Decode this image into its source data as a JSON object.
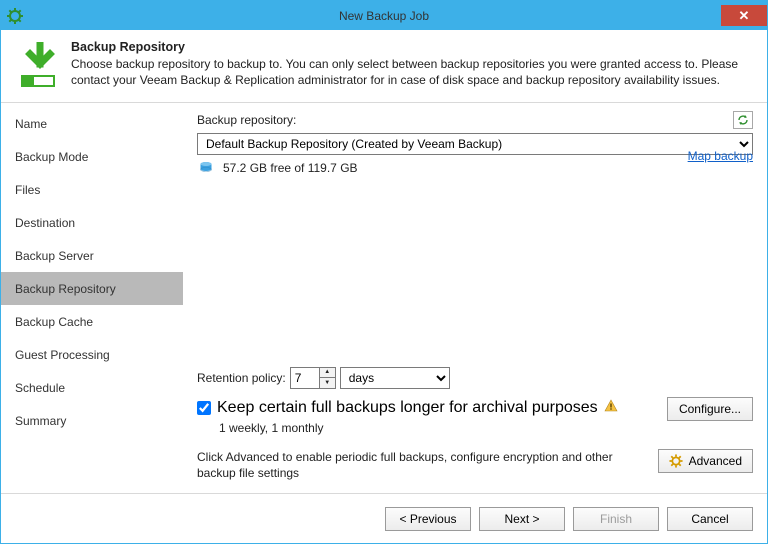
{
  "window": {
    "title": "New Backup Job"
  },
  "header": {
    "title": "Backup Repository",
    "description": "Choose backup repository to backup to. You can only select between backup repositories you were granted access to. Please contact your Veeam Backup & Replication administrator for in case of disk space and backup repository availability issues."
  },
  "sidebar": {
    "items": [
      {
        "label": "Name"
      },
      {
        "label": "Backup Mode"
      },
      {
        "label": "Files"
      },
      {
        "label": "Destination"
      },
      {
        "label": "Backup Server"
      },
      {
        "label": "Backup Repository",
        "active": true
      },
      {
        "label": "Backup Cache"
      },
      {
        "label": "Guest Processing"
      },
      {
        "label": "Schedule"
      },
      {
        "label": "Summary"
      }
    ]
  },
  "main": {
    "repo_label": "Backup repository:",
    "repo_value": "Default Backup Repository (Created by Veeam Backup)",
    "disk_free": "57.2 GB free of 119.7 GB",
    "map_link": "Map backup",
    "retention_label": "Retention policy:",
    "retention_value": "7",
    "retention_unit": "days",
    "keep_full_label": "Keep certain full backups longer for archival purposes",
    "keep_full_summary": "1 weekly, 1 monthly",
    "configure_btn": "Configure...",
    "advanced_hint": "Click Advanced to enable periodic full backups, configure encryption and other backup file settings",
    "advanced_btn": "Advanced"
  },
  "footer": {
    "previous": "< Previous",
    "next": "Next >",
    "finish": "Finish",
    "cancel": "Cancel"
  }
}
